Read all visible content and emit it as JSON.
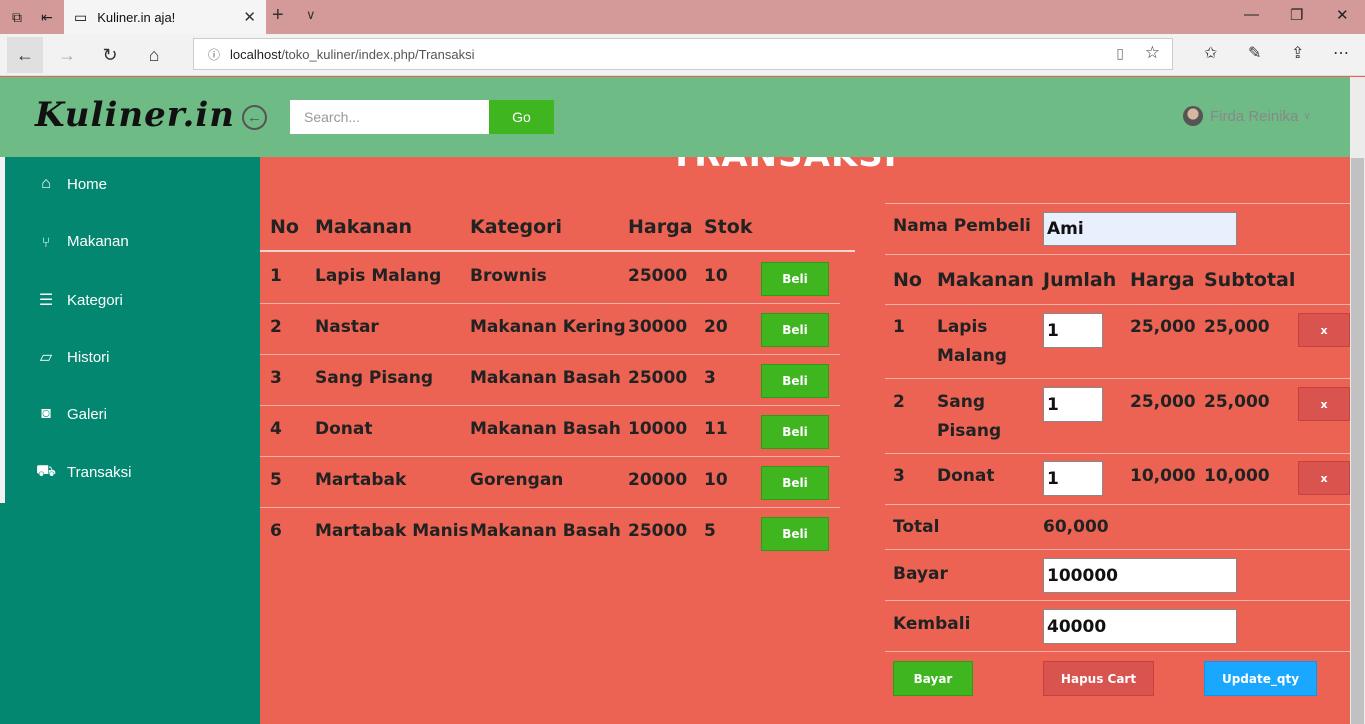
{
  "browser": {
    "tab_title": "Kuliner.in aja!",
    "url_host": "localhost",
    "url_path": "/toko_kuliner/index.php/Transaksi"
  },
  "header": {
    "logo": "Kuliner.in",
    "search_placeholder": "Search...",
    "go_label": "Go",
    "user_name": "Firda Reinika"
  },
  "sidebar": {
    "items": [
      {
        "label": "Home",
        "icon": "home-icon"
      },
      {
        "label": "Makanan",
        "icon": "cutlery-icon"
      },
      {
        "label": "Kategori",
        "icon": "list-icon"
      },
      {
        "label": "Histori",
        "icon": "folder-open-icon"
      },
      {
        "label": "Galeri",
        "icon": "camera-icon"
      },
      {
        "label": "Transaksi",
        "icon": "cart-icon"
      }
    ]
  },
  "page": {
    "title": "TRANSAKSI"
  },
  "products": {
    "headers": [
      "No",
      "Makanan",
      "Kategori",
      "Harga",
      "Stok"
    ],
    "buy_label": "Beli",
    "rows": [
      {
        "no": "1",
        "name": "Lapis Malang",
        "category": "Brownis",
        "price": "25000",
        "stock": "10"
      },
      {
        "no": "2",
        "name": "Nastar",
        "category": "Makanan Kering",
        "price": "30000",
        "stock": "20"
      },
      {
        "no": "3",
        "name": "Sang Pisang",
        "category": "Makanan Basah",
        "price": "25000",
        "stock": "3"
      },
      {
        "no": "4",
        "name": "Donat",
        "category": "Makanan Basah",
        "price": "10000",
        "stock": "11"
      },
      {
        "no": "5",
        "name": "Martabak",
        "category": "Gorengan",
        "price": "20000",
        "stock": "10"
      },
      {
        "no": "6",
        "name": "Martabak Manis",
        "category": "Makanan Basah",
        "price": "25000",
        "stock": "5"
      }
    ]
  },
  "cart": {
    "buyer_label": "Nama Pembeli",
    "buyer_value": "Ami",
    "headers": [
      "No",
      "Makanan",
      "Jumlah",
      "Harga",
      "Subtotal"
    ],
    "remove_label": "x",
    "rows": [
      {
        "no": "1",
        "name_line1": "Lapis",
        "name_line2": "Malang",
        "qty": "1",
        "price": "25,000",
        "subtotal": "25,000"
      },
      {
        "no": "2",
        "name_line1": "Sang",
        "name_line2": "Pisang",
        "qty": "1",
        "price": "25,000",
        "subtotal": "25,000"
      },
      {
        "no": "3",
        "name_line1": "Donat",
        "name_line2": "",
        "qty": "1",
        "price": "10,000",
        "subtotal": "10,000"
      }
    ],
    "total_label": "Total",
    "total_value": "60,000",
    "pay_label": "Bayar",
    "pay_value": "100000",
    "change_label": "Kembali",
    "change_value": "40000",
    "btn_pay": "Bayar",
    "btn_clear": "Hapus Cart",
    "btn_update": "Update_qty"
  }
}
